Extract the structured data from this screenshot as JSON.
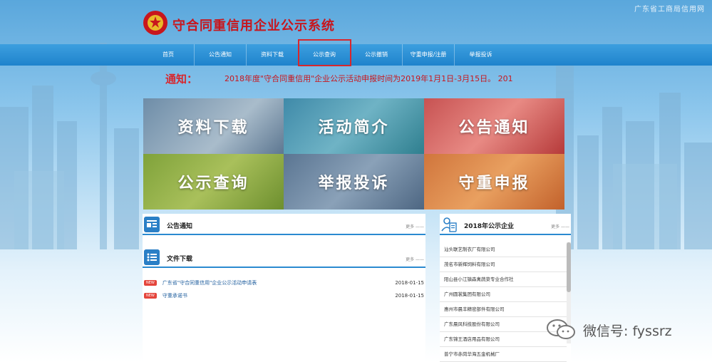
{
  "header": {
    "top_right_text": "广东省工商局信用网",
    "site_title": "守合同重信用企业公示系统",
    "logo": "national-emblem-icon"
  },
  "nav": {
    "items": [
      "首页",
      "公告通知",
      "资料下载",
      "公示查询",
      "公示撤销",
      "守重申报/注册",
      "举报投诉"
    ],
    "active": "公示查询"
  },
  "notice": {
    "label": "通知：",
    "text": "2018年度\"守合同重信用\"企业公示活动申报时间为2019年1月1日-3月15日。      201"
  },
  "tiles": [
    "资料下载",
    "活动简介",
    "公告通知",
    "公示查询",
    "举报投诉",
    "守重申报"
  ],
  "announcements": {
    "title": "公告通知",
    "more": "更多 ——",
    "icon": "news-icon"
  },
  "downloads": {
    "title": "文件下载",
    "more": "更多 ——",
    "icon": "document-list-icon",
    "badge": "NEW",
    "files": [
      {
        "name": "广东省\"守合同重信用\"企业公示活动申请表",
        "date": "2018-01-15"
      },
      {
        "name": "守重承诺书",
        "date": "2018-01-15"
      }
    ]
  },
  "companies": {
    "title": "2018年公示企业",
    "more": "更多 ——",
    "icon": "person-document-icon",
    "items": [
      "汕头联艺制衣厂有限公司",
      "茂名市新辉饲料有限公司",
      "阳山县小江镇森禽蔬菜专业合作社",
      "广州圆裳集团有限公司",
      "惠州市晨丰精密部件有限公司",
      "广东晨风科技股份有限公司",
      "广东锦王酒店用品有限公司",
      "普宁市赤岗华海五金机械厂"
    ]
  },
  "watermark": {
    "text": "微信号: fyssrz",
    "icon": "wechat-icon"
  },
  "colors": {
    "accent_red": "#d8262c",
    "nav_blue": "#1f83cc",
    "link_blue": "#1f5e9e"
  }
}
